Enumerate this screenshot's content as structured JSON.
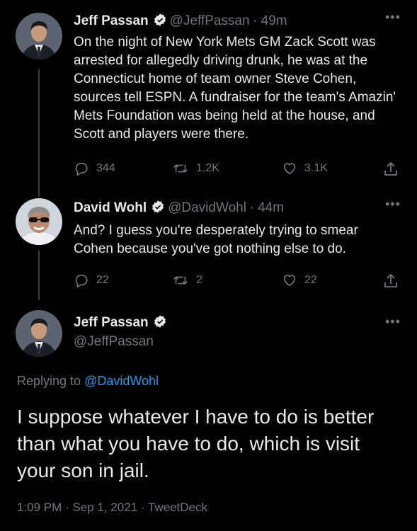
{
  "tweet1": {
    "name": "Jeff Passan",
    "handle": "@JeffPassan",
    "time": "· 49m",
    "text": "On the night of New York Mets GM Zack Scott was arrested for allegedly driving drunk, he was at the Connecticut home of team owner Steve Cohen, sources tell ESPN. A fundraiser for the team's Amazin' Mets Foundation was being held at the house, and Scott and players were there.",
    "replies": "344",
    "retweets": "1.2K",
    "likes": "3.1K"
  },
  "tweet2": {
    "name": "David Wohl",
    "handle": "@DavidWohl",
    "time": "· 44m",
    "text": "And? I guess you're desperately trying to smear Cohen because you've got nothing else to do.",
    "replies": "22",
    "retweets": "2",
    "likes": "22"
  },
  "tweet3": {
    "name": "Jeff Passan",
    "handle": "@JeffPassan",
    "replying_prefix": "Replying to",
    "replying_to": "@DavidWohl",
    "text": "I suppose whatever I have to do is better than what you have to do, which is visit your son in jail.",
    "timestamp": "1:09 PM · Sep 1, 2021 · TweetDeck"
  },
  "icons": {
    "verified": "verified-badge-icon",
    "reply": "reply-icon",
    "retweet": "retweet-icon",
    "like": "heart-icon",
    "share": "share-icon",
    "more": "more-icon"
  },
  "colors": {
    "background": "#000000",
    "text": "#e7e9ea",
    "muted": "#71767b",
    "link": "#1d9bf0"
  }
}
